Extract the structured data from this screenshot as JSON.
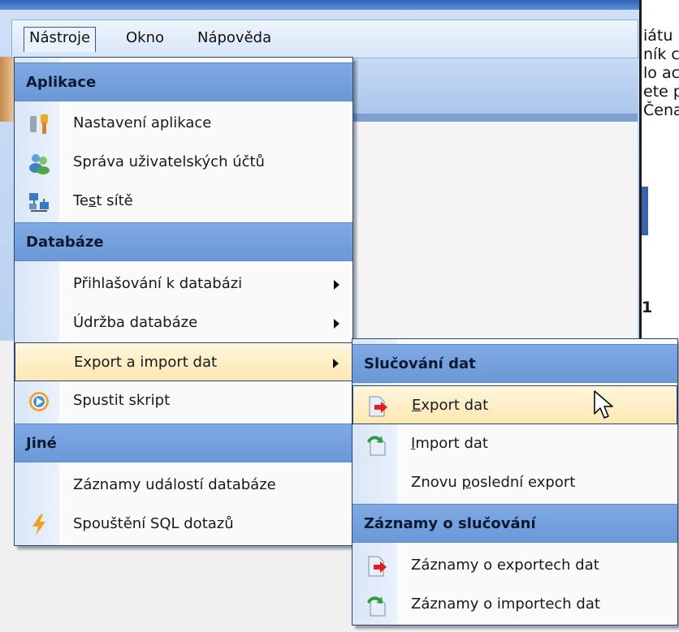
{
  "menubar": {
    "items": [
      "Nástroje",
      "Okno",
      "Nápověda"
    ]
  },
  "background_doc": {
    "lines": [
      "iátu",
      "ník c",
      "lo ac",
      "ete p",
      "Čena"
    ],
    "number": "1"
  },
  "main_menu": {
    "sections": [
      {
        "header": "Aplikace",
        "items": [
          {
            "label": "Nastavení aplikace",
            "icon": "tools-icon"
          },
          {
            "label": "Správa uživatelských účtů",
            "icon": "users-icon"
          },
          {
            "label_parts": [
              "Te",
              "s",
              "t sítě"
            ],
            "icon": "network-icon"
          }
        ]
      },
      {
        "header": "Databáze",
        "items": [
          {
            "label": "Přihlašování k databázi",
            "submenu": true
          },
          {
            "label": "Údržba databáze",
            "submenu": true
          },
          {
            "label": "Export a import dat",
            "submenu": true,
            "highlighted": true
          },
          {
            "label": "Spustit skript",
            "icon": "play-script-icon"
          }
        ]
      },
      {
        "header": "Jiné",
        "items": [
          {
            "label": "Záznamy událostí databáze"
          },
          {
            "label": "Spouštění SQL dotazů",
            "icon": "lightning-icon"
          }
        ]
      }
    ]
  },
  "sub_menu": {
    "sections": [
      {
        "header": "Slučování dat",
        "items": [
          {
            "label_parts": [
              "",
              "E",
              "xport dat"
            ],
            "icon": "export-icon",
            "highlighted": true
          },
          {
            "label_parts": [
              "",
              "I",
              "mport dat"
            ],
            "icon": "import-icon"
          },
          {
            "label_parts": [
              "Znovu ",
              "p",
              "oslední export"
            ]
          }
        ]
      },
      {
        "header": "Záznamy o slučování",
        "items": [
          {
            "label": "Záznamy o exportech dat",
            "icon": "export-icon"
          },
          {
            "label": "Záznamy o importech dat",
            "icon": "import-icon"
          }
        ]
      }
    ]
  },
  "colors": {
    "header_blue": "#7fa9e3",
    "highlight": "#fde7b3",
    "border": "#26467a"
  }
}
